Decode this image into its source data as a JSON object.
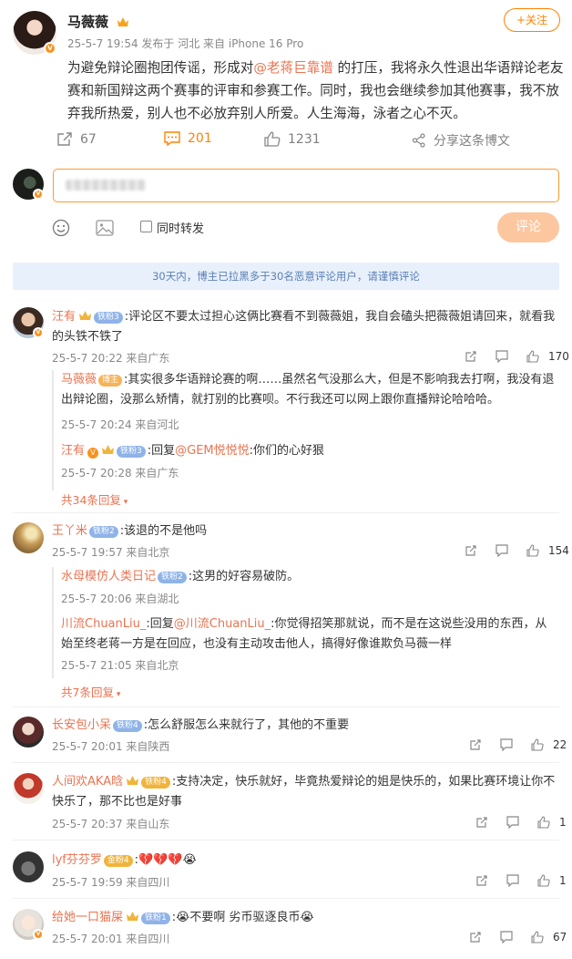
{
  "post": {
    "author": "马薇薇",
    "meta": "25-5-7 19:54  发布于 河北  来自 iPhone 16 Pro",
    "follow_label": "+关注",
    "text_before": "为避免辩论圈抱团传谣，形成对",
    "mention": "@老蒋巨靠谱",
    "text_after": " 的打压，我将永久性退出华语辩论老友赛和新国辩这两个赛事的评审和参赛工作。同时，我也会继续参加其他赛事，我不放弃我所热爱，别人也不必放弃别人所爱。人生海海，泳者之心不灭。",
    "repost_count": "67",
    "comment_count": "201",
    "like_count": "1231",
    "share_label": "分享这条博文"
  },
  "compose": {
    "repost_label": "同时转发",
    "submit_label": "评论"
  },
  "notice": "30天内，博主已拉黑多于30名恶意评论用户，请谨慎评论",
  "comments": [
    {
      "name": "汪有",
      "badge": "铁粉3",
      "text": ":评论区不要太过担心这俩比赛看不到薇薇姐，我自会磕头把薇薇姐请回来，就看我的头铁不铁了",
      "meta": "25-5-7 20:22 来自广东",
      "likes": "170",
      "replies": [
        {
          "name": "马薇薇",
          "badge": "博主",
          "text": ":其实很多华语辩论赛的啊……虽然名气没那么大，但是不影响我去打啊，我没有退出辩论圈，没那么矫情，就打别的比赛呗。不行我还可以网上跟你直播辩论哈哈哈。",
          "meta": "25-5-7 20:24 来自河北"
        },
        {
          "name": "汪有",
          "badge": "铁粉3",
          "reply_prefix": ":回复",
          "reply_to": "@GEM悦悦悦",
          "text": ":你们的心好狠",
          "meta": "25-5-7 20:28 来自广东"
        }
      ],
      "more": "共34条回复"
    },
    {
      "name": "王丫米",
      "badge": "铁粉2",
      "text": ":该退的不是他吗",
      "meta": "25-5-7 19:57 来自北京",
      "likes": "154",
      "replies": [
        {
          "name": "水母模仿人类日记",
          "badge": "铁粉2",
          "text": ":这男的好容易破防。",
          "meta": "25-5-7 20:06 来自湖北"
        },
        {
          "name": "川流ChuanLiu_",
          "reply_prefix": ":回复",
          "reply_to": "@川流ChuanLiu_",
          "text": ":你觉得招笑那就说，而不是在这说些没用的东西，从始至终老蒋一方是在回应，也没有主动攻击他人，搞得好像谁欺负马薇一样",
          "meta": "25-5-7 21:05 来自北京"
        }
      ],
      "more": "共7条回复"
    },
    {
      "name": "长安包小呆",
      "badge": "铁粉4",
      "text": ":怎么舒服怎么来就行了，其他的不重要",
      "meta": "25-5-7 20:01 来自陕西",
      "likes": "22"
    },
    {
      "name": "人间欢AKA晗",
      "badge": "铁粉4",
      "text": ":支持决定，快乐就好，毕竟热爱辩论的姐是快乐的，如果比赛环境让你不快乐了，那不比也是好事",
      "meta": "25-5-7 20:37 来自山东",
      "likes": "1"
    },
    {
      "name": "lyf芬芬罗",
      "badge": "金粉4",
      "text": ":💔💔💔😭",
      "meta": "25-5-7 19:59 来自四川",
      "likes": "1"
    },
    {
      "name": "给她一口猫屎",
      "badge": "铁粉1",
      "text": ":😭不要啊 劣币驱逐良币😭",
      "meta": "25-5-7 20:01 来自四川",
      "likes": "67"
    }
  ],
  "colors": {
    "accent": "#ff8200",
    "name": "#eb7350",
    "notice_bg": "#e8f0fb"
  }
}
